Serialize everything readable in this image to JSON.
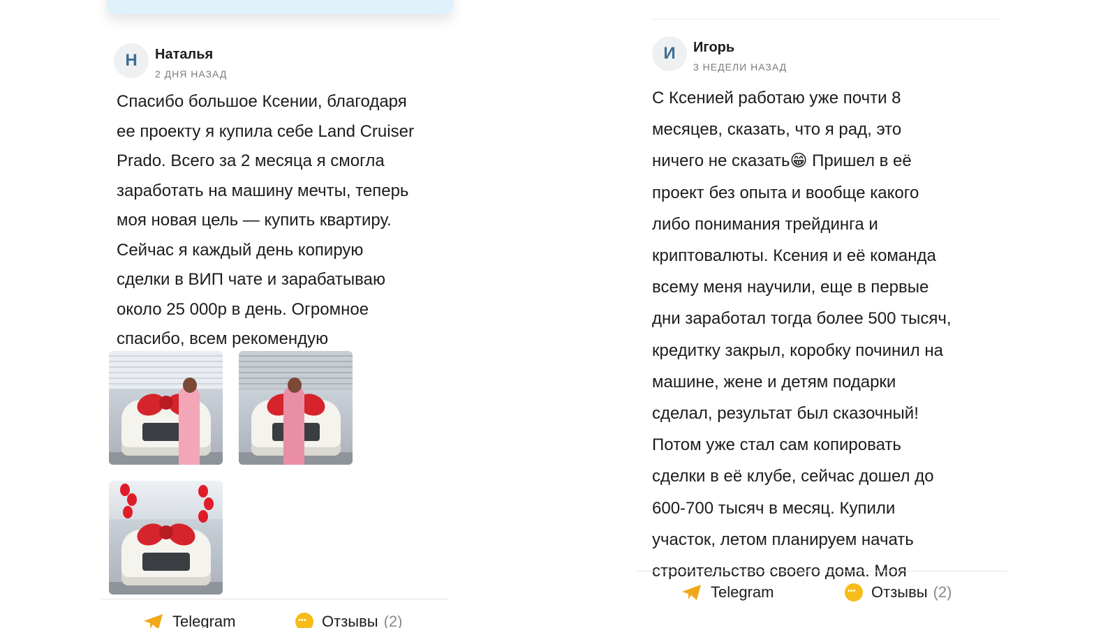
{
  "left_review": {
    "avatar_initial": "Н",
    "author": "Наталья",
    "date": "2 дня назад",
    "text": "Спасибо большое Ксении, благодаря\nее проекту я купила себе Land Cruiser\nPrado. Всего за 2 месяца я смогла\nзаработать на машину мечты, теперь\nмоя новая цель — купить квартиру.\nСейчас я каждый день копирую\nсделки в ВИП чате и зарабатываю\nоколо 25 000р в день. Огромное\nспасибо, всем рекомендую",
    "photos": [
      "car-photo-1",
      "car-photo-2",
      "car-photo-3"
    ]
  },
  "right_review": {
    "avatar_initial": "И",
    "author": "Игорь",
    "date": "3 недели назад",
    "text": "С Ксенией работаю уже почти 8\nмесяцев, сказать, что я рад, это\nничего не сказать😁 Пришел в её\nпроект без опыта и вообще какого\nлибо понимания трейдинга и\nкриптовалюты. Ксения и её команда\nвсему меня научили, еще в первые\nдни заработал тогда более 500 тысяч,\nкредитку закрыл, коробку починил на\nмашине, жене и детям подарки\nсделал, результат был сказочный!\nПотом уже стал сам копировать\nсделки в её клубе, сейчас дошел до\n600-700 тысяч в месяц. Купили\nучасток, летом планируем начать\nстроительство своего дома. Моя"
  },
  "footer": {
    "telegram_label": "Telegram",
    "reviews_label": "Отзывы",
    "reviews_count": "(2)"
  },
  "colors": {
    "avatar_text": "#3d6e93",
    "telegram_icon": "#f0a81b",
    "chat_icon": "#f5bc1a"
  }
}
